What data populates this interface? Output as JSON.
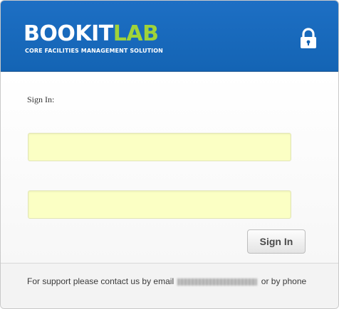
{
  "header": {
    "logo_part_a": "BOOKIT",
    "logo_part_b": "LAB",
    "tagline": "CORE FACILITIES MANAGEMENT SOLUTION",
    "lock_icon": "lock-icon",
    "colors": {
      "banner": "#1464b4",
      "logo_accent": "#9fd33a"
    }
  },
  "form": {
    "label": "Sign In:",
    "username_value": "",
    "password_value": "",
    "field_color": "#fbffc4",
    "submit_label": "Sign In"
  },
  "footer": {
    "support_prefix": "For support please contact us by email",
    "support_suffix": "or by phone"
  }
}
